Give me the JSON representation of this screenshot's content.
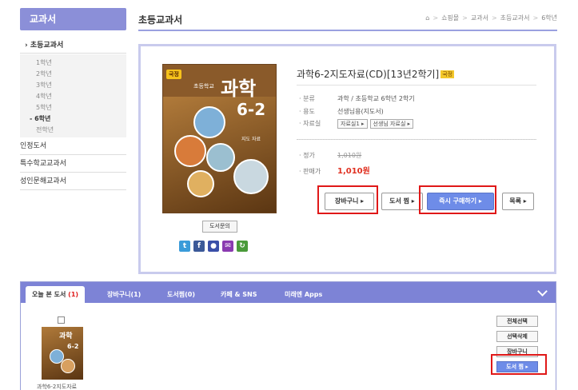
{
  "sidebar": {
    "header": "교과서",
    "current": "초등교과서",
    "grades": [
      "1학년",
      "2학년",
      "3학년",
      "4학년",
      "5학년",
      "6학년",
      "전학년"
    ],
    "active_grade_index": 5,
    "items": [
      "인정도서",
      "특수학교교과서",
      "성인문해교과서"
    ]
  },
  "header": {
    "title": "초등교과서",
    "breadcrumb": [
      "쇼핑몰",
      "교과서",
      "초등교과서",
      "6학년"
    ]
  },
  "book": {
    "cover": {
      "badge": "국정",
      "subtitle": "초등학교",
      "title": "과학",
      "number": "6-2",
      "edition": "지도 자료"
    },
    "title": "과학6-2지도자료(CD)[13년2학기]",
    "tag": "국정",
    "info": [
      {
        "key": "분류",
        "value": "과학 / 초등학교 6학년 2학기"
      },
      {
        "key": "용도",
        "value": "선생님용(지도서)"
      }
    ],
    "materials_key": "자료실",
    "materials": [
      "자료실1 ▸",
      "선생님 자료실 ▸"
    ],
    "price_key": "정가",
    "price": "1,010원",
    "sale_key": "판매가",
    "sale_price": "1,010원",
    "inquiry_label": "도서문의",
    "sns": [
      {
        "icon": "twitter-icon",
        "glyph": "t",
        "color": "#3a9bd9"
      },
      {
        "icon": "facebook-icon",
        "glyph": "f",
        "color": "#3b5998"
      },
      {
        "icon": "me2day-icon",
        "glyph": "●",
        "color": "#3a4fa8"
      },
      {
        "icon": "mail-icon",
        "glyph": "✉",
        "color": "#8a3ab0"
      },
      {
        "icon": "share-icon",
        "glyph": "↻",
        "color": "#4a9a3a"
      }
    ]
  },
  "actions": {
    "cart": "장바구니 ▸",
    "wish": "도서 찜 ▸",
    "buy": "즉시 구매하기 ▸",
    "list": "목록 ▸"
  },
  "bottom": {
    "tabs": [
      {
        "label": "오늘 본 도서",
        "count": "(1)"
      },
      {
        "label": "장바구니",
        "count": "(1)"
      },
      {
        "label": "도서찜",
        "count": "(0)"
      },
      {
        "label": "카페 & SNS",
        "count": ""
      },
      {
        "label": "미래엔 Apps",
        "count": ""
      }
    ],
    "thumb_title": "과학",
    "thumb_num": "6-2",
    "thumb_caption": "과학6-2지도자료",
    "side_buttons": [
      "전체선택",
      "선택삭제",
      "장바구니",
      "도서 찜 ▸"
    ]
  }
}
